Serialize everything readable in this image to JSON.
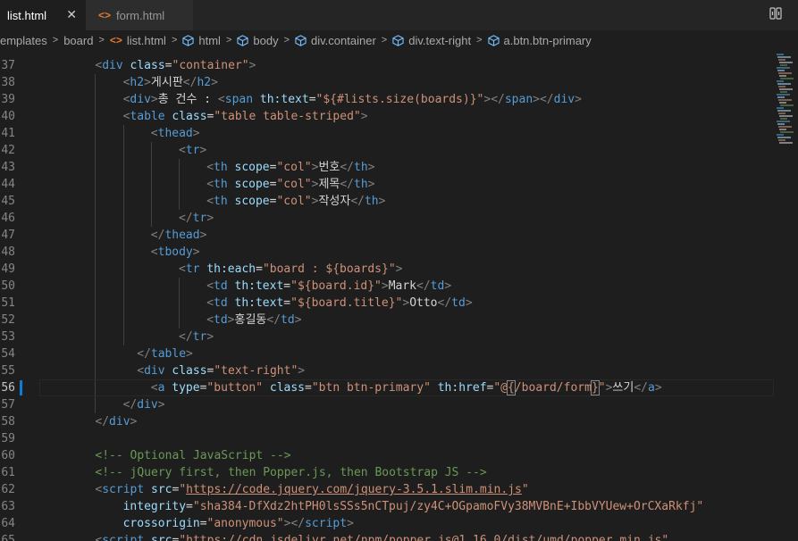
{
  "tabs": [
    {
      "label": "list.html",
      "active": true
    },
    {
      "label": "form.html",
      "active": false
    }
  ],
  "icons": {
    "html": "html-file-icon",
    "close": "close-icon",
    "compare": "compare-icon",
    "element": "element-cube-icon"
  },
  "breadcrumb": [
    "emplates",
    "board",
    "list.html",
    "html",
    "body",
    "div.container",
    "div.text-right",
    "a.btn.btn-primary"
  ],
  "active_line": 56,
  "colors": {
    "tag": "#569cd6",
    "attr": "#9cdcfe",
    "string": "#ce9178",
    "comment": "#6a9955",
    "text": "#d4d4d4",
    "bracket": "#808080"
  },
  "lines": [
    {
      "n": 37,
      "indent": 2,
      "tokens": [
        [
          "br",
          "<"
        ],
        [
          "tag",
          "div"
        ],
        [
          "txt",
          " "
        ],
        [
          "attr",
          "class"
        ],
        [
          "txt",
          "="
        ],
        [
          "str",
          "\"container\""
        ],
        [
          "br",
          ">"
        ]
      ]
    },
    {
      "n": 38,
      "indent": 3,
      "tokens": [
        [
          "br",
          "<"
        ],
        [
          "tag",
          "h2"
        ],
        [
          "br",
          ">"
        ],
        [
          "txt",
          "게시판"
        ],
        [
          "br",
          "</"
        ],
        [
          "tag",
          "h2"
        ],
        [
          "br",
          ">"
        ]
      ]
    },
    {
      "n": 39,
      "indent": 3,
      "tokens": [
        [
          "br",
          "<"
        ],
        [
          "tag",
          "div"
        ],
        [
          "br",
          ">"
        ],
        [
          "txt",
          "총 건수 : "
        ],
        [
          "br",
          "<"
        ],
        [
          "tag",
          "span"
        ],
        [
          "txt",
          " "
        ],
        [
          "attr",
          "th:text"
        ],
        [
          "txt",
          "="
        ],
        [
          "str",
          "\"${#lists.size(boards)}\""
        ],
        [
          "br",
          ">"
        ],
        [
          "br",
          "</"
        ],
        [
          "tag",
          "span"
        ],
        [
          "br",
          ">"
        ],
        [
          "br",
          "</"
        ],
        [
          "tag",
          "div"
        ],
        [
          "br",
          ">"
        ]
      ]
    },
    {
      "n": 40,
      "indent": 3,
      "tokens": [
        [
          "br",
          "<"
        ],
        [
          "tag",
          "table"
        ],
        [
          "txt",
          " "
        ],
        [
          "attr",
          "class"
        ],
        [
          "txt",
          "="
        ],
        [
          "str",
          "\"table table-striped\""
        ],
        [
          "br",
          ">"
        ]
      ]
    },
    {
      "n": 41,
      "indent": 4,
      "tokens": [
        [
          "br",
          "<"
        ],
        [
          "tag",
          "thead"
        ],
        [
          "br",
          ">"
        ]
      ]
    },
    {
      "n": 42,
      "indent": 5,
      "tokens": [
        [
          "br",
          "<"
        ],
        [
          "tag",
          "tr"
        ],
        [
          "br",
          ">"
        ]
      ]
    },
    {
      "n": 43,
      "indent": 6,
      "tokens": [
        [
          "br",
          "<"
        ],
        [
          "tag",
          "th"
        ],
        [
          "txt",
          " "
        ],
        [
          "attr",
          "scope"
        ],
        [
          "txt",
          "="
        ],
        [
          "str",
          "\"col\""
        ],
        [
          "br",
          ">"
        ],
        [
          "txt",
          "번호"
        ],
        [
          "br",
          "</"
        ],
        [
          "tag",
          "th"
        ],
        [
          "br",
          ">"
        ]
      ]
    },
    {
      "n": 44,
      "indent": 6,
      "tokens": [
        [
          "br",
          "<"
        ],
        [
          "tag",
          "th"
        ],
        [
          "txt",
          " "
        ],
        [
          "attr",
          "scope"
        ],
        [
          "txt",
          "="
        ],
        [
          "str",
          "\"col\""
        ],
        [
          "br",
          ">"
        ],
        [
          "txt",
          "제목"
        ],
        [
          "br",
          "</"
        ],
        [
          "tag",
          "th"
        ],
        [
          "br",
          ">"
        ]
      ]
    },
    {
      "n": 45,
      "indent": 6,
      "tokens": [
        [
          "br",
          "<"
        ],
        [
          "tag",
          "th"
        ],
        [
          "txt",
          " "
        ],
        [
          "attr",
          "scope"
        ],
        [
          "txt",
          "="
        ],
        [
          "str",
          "\"col\""
        ],
        [
          "br",
          ">"
        ],
        [
          "txt",
          "작성자"
        ],
        [
          "br",
          "</"
        ],
        [
          "tag",
          "th"
        ],
        [
          "br",
          ">"
        ]
      ]
    },
    {
      "n": 46,
      "indent": 5,
      "tokens": [
        [
          "br",
          "</"
        ],
        [
          "tag",
          "tr"
        ],
        [
          "br",
          ">"
        ]
      ]
    },
    {
      "n": 47,
      "indent": 4,
      "tokens": [
        [
          "br",
          "</"
        ],
        [
          "tag",
          "thead"
        ],
        [
          "br",
          ">"
        ]
      ]
    },
    {
      "n": 48,
      "indent": 4,
      "tokens": [
        [
          "br",
          "<"
        ],
        [
          "tag",
          "tbody"
        ],
        [
          "br",
          ">"
        ]
      ]
    },
    {
      "n": 49,
      "indent": 5,
      "tokens": [
        [
          "br",
          "<"
        ],
        [
          "tag",
          "tr"
        ],
        [
          "txt",
          " "
        ],
        [
          "attr",
          "th:each"
        ],
        [
          "txt",
          "="
        ],
        [
          "str",
          "\"board : ${boards}\""
        ],
        [
          "br",
          ">"
        ]
      ]
    },
    {
      "n": 50,
      "indent": 6,
      "tokens": [
        [
          "br",
          "<"
        ],
        [
          "tag",
          "td"
        ],
        [
          "txt",
          " "
        ],
        [
          "attr",
          "th:text"
        ],
        [
          "txt",
          "="
        ],
        [
          "str",
          "\"${board.id}\""
        ],
        [
          "br",
          ">"
        ],
        [
          "txt",
          "Mark"
        ],
        [
          "br",
          "</"
        ],
        [
          "tag",
          "td"
        ],
        [
          "br",
          ">"
        ]
      ]
    },
    {
      "n": 51,
      "indent": 6,
      "tokens": [
        [
          "br",
          "<"
        ],
        [
          "tag",
          "td"
        ],
        [
          "txt",
          " "
        ],
        [
          "attr",
          "th:text"
        ],
        [
          "txt",
          "="
        ],
        [
          "str",
          "\"${board.title}\""
        ],
        [
          "br",
          ">"
        ],
        [
          "txt",
          "Otto"
        ],
        [
          "br",
          "</"
        ],
        [
          "tag",
          "td"
        ],
        [
          "br",
          ">"
        ]
      ]
    },
    {
      "n": 52,
      "indent": 6,
      "tokens": [
        [
          "br",
          "<"
        ],
        [
          "tag",
          "td"
        ],
        [
          "br",
          ">"
        ],
        [
          "txt",
          "홍길동"
        ],
        [
          "br",
          "</"
        ],
        [
          "tag",
          "td"
        ],
        [
          "br",
          ">"
        ]
      ]
    },
    {
      "n": 53,
      "indent": 5,
      "tokens": [
        [
          "br",
          "</"
        ],
        [
          "tag",
          "tr"
        ],
        [
          "br",
          ">"
        ]
      ]
    },
    {
      "n": 54,
      "indent": 3,
      "tokens": [
        [
          "txt",
          "  "
        ],
        [
          "br",
          "</"
        ],
        [
          "tag",
          "table"
        ],
        [
          "br",
          ">"
        ]
      ]
    },
    {
      "n": 55,
      "indent": 3,
      "tokens": [
        [
          "txt",
          "  "
        ],
        [
          "br",
          "<"
        ],
        [
          "tag",
          "div"
        ],
        [
          "txt",
          " "
        ],
        [
          "attr",
          "class"
        ],
        [
          "txt",
          "="
        ],
        [
          "str",
          "\"text-right\""
        ],
        [
          "br",
          ">"
        ]
      ]
    },
    {
      "n": 56,
      "indent": 4,
      "tokens": [
        [
          "br",
          "<"
        ],
        [
          "tag",
          "a"
        ],
        [
          "txt",
          " "
        ],
        [
          "attr",
          "type"
        ],
        [
          "txt",
          "="
        ],
        [
          "str",
          "\"button\""
        ],
        [
          "txt",
          " "
        ],
        [
          "attr",
          "class"
        ],
        [
          "txt",
          "="
        ],
        [
          "str",
          "\"btn btn-primary\""
        ],
        [
          "txt",
          " "
        ],
        [
          "attr",
          "th:href"
        ],
        [
          "txt",
          "="
        ],
        [
          "str",
          "\"@"
        ],
        [
          "match",
          "{"
        ],
        [
          "str",
          "/board/form"
        ],
        [
          "match",
          "}"
        ],
        [
          "str",
          "\""
        ],
        [
          "br",
          ">"
        ],
        [
          "txt",
          "쓰기"
        ],
        [
          "br",
          "</"
        ],
        [
          "tag",
          "a"
        ],
        [
          "br",
          ">"
        ]
      ]
    },
    {
      "n": 57,
      "indent": 3,
      "tokens": [
        [
          "br",
          "</"
        ],
        [
          "tag",
          "div"
        ],
        [
          "br",
          ">"
        ]
      ]
    },
    {
      "n": 58,
      "indent": 2,
      "tokens": [
        [
          "br",
          "</"
        ],
        [
          "tag",
          "div"
        ],
        [
          "br",
          ">"
        ]
      ]
    },
    {
      "n": 59,
      "indent": 0,
      "tokens": []
    },
    {
      "n": 60,
      "indent": 2,
      "tokens": [
        [
          "com",
          "<!-- Optional JavaScript -->"
        ]
      ]
    },
    {
      "n": 61,
      "indent": 2,
      "tokens": [
        [
          "com",
          "<!-- jQuery first, then Popper.js, then Bootstrap JS -->"
        ]
      ]
    },
    {
      "n": 62,
      "indent": 2,
      "tokens": [
        [
          "br",
          "<"
        ],
        [
          "tag",
          "script"
        ],
        [
          "txt",
          " "
        ],
        [
          "attr",
          "src"
        ],
        [
          "txt",
          "="
        ],
        [
          "str",
          "\""
        ],
        [
          "link",
          "https://code.jquery.com/jquery-3.5.1.slim.min.js"
        ],
        [
          "str",
          "\""
        ]
      ]
    },
    {
      "n": 63,
      "indent": 3,
      "tokens": [
        [
          "attr",
          "integrity"
        ],
        [
          "txt",
          "="
        ],
        [
          "str",
          "\"sha384-DfXdz2htPH0lsSSs5nCTpuj/zy4C+OGpamoFVy38MVBnE+IbbVYUew+OrCXaRkfj\""
        ]
      ]
    },
    {
      "n": 64,
      "indent": 3,
      "tokens": [
        [
          "attr",
          "crossorigin"
        ],
        [
          "txt",
          "="
        ],
        [
          "str",
          "\"anonymous\""
        ],
        [
          "br",
          "></"
        ],
        [
          "tag",
          "script"
        ],
        [
          "br",
          ">"
        ]
      ]
    },
    {
      "n": 65,
      "indent": 2,
      "tokens": [
        [
          "br",
          "<"
        ],
        [
          "tag",
          "script"
        ],
        [
          "txt",
          " "
        ],
        [
          "attr",
          "src"
        ],
        [
          "txt",
          "="
        ],
        [
          "str",
          "\"https://cdn.jsdelivr.net/npm/popper.js@1.16.0/dist/umd/popper.min.js\""
        ]
      ]
    }
  ]
}
